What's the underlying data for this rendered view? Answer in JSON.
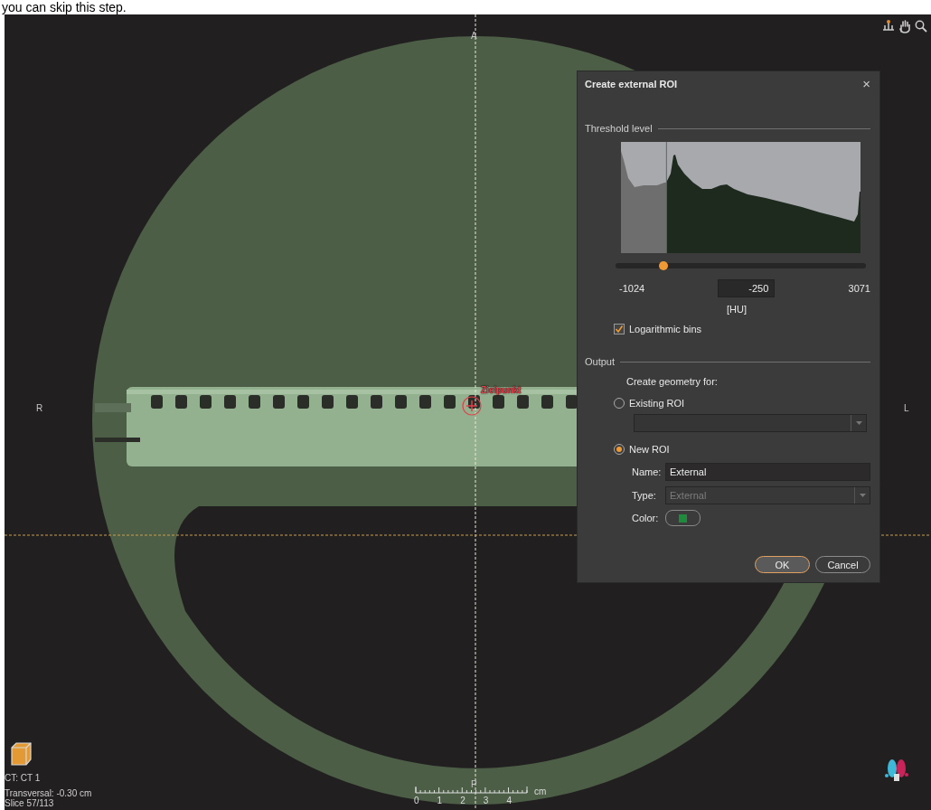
{
  "page_caption": "you can skip this step.",
  "viewer": {
    "orientation_labels": [
      {
        "kind": "top",
        "text": "A"
      },
      {
        "kind": "left",
        "text": "R"
      },
      {
        "kind": "right",
        "text": "L"
      },
      {
        "kind": "bottom",
        "text": "P"
      }
    ],
    "target": {
      "label": "Zielpunkt"
    },
    "info": [
      "CT: CT 1",
      "Transversal: -0.30 cm",
      "Slice 57/113"
    ],
    "scale": {
      "ticks": [
        "0",
        "1",
        "2",
        "3",
        "4"
      ],
      "unit": "cm"
    }
  },
  "dialog": {
    "title": "Create external ROI",
    "close": "×",
    "threshold": {
      "heading": "Threshold level",
      "level": 0.19,
      "min": "-1024",
      "value": "-250",
      "max": "3071",
      "unit": "[HU]",
      "log_bins": {
        "label": "Logarithmic bins",
        "checked": true
      }
    },
    "output": {
      "heading": "Output",
      "prompt": "Create geometry for:",
      "options": [
        {
          "kind": "existing",
          "label": "Existing ROI",
          "selected": false
        },
        {
          "kind": "new",
          "label": "New ROI",
          "selected": true
        }
      ],
      "fields": [
        {
          "kind": "text",
          "label": "Name:",
          "value": "External"
        },
        {
          "kind": "select",
          "label": "Type:",
          "value": "External",
          "disabled": true
        },
        {
          "kind": "color",
          "label": "Color:",
          "color": "#1e8a3c"
        }
      ]
    },
    "buttons": [
      {
        "label": "OK",
        "default": true
      },
      {
        "label": "Cancel",
        "default": false
      }
    ]
  }
}
